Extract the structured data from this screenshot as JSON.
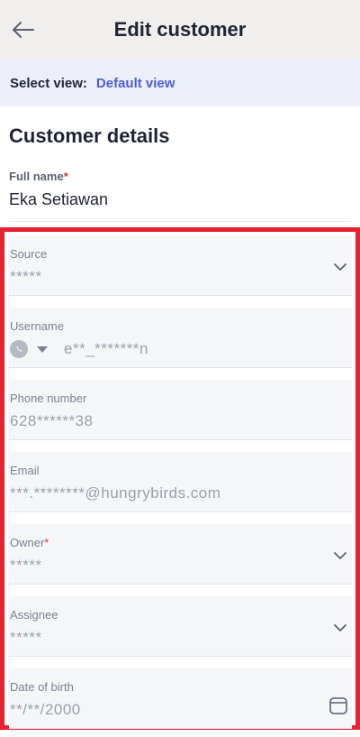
{
  "header": {
    "title": "Edit customer",
    "back_icon": "arrow-left-icon"
  },
  "view_bar": {
    "label": "Select view:",
    "link": "Default view"
  },
  "section": {
    "title": "Customer details"
  },
  "full_name": {
    "label": "Full name",
    "required": "*",
    "value": "Eka Setiawan"
  },
  "fields": {
    "source": {
      "label": "Source",
      "value": "*****"
    },
    "username": {
      "label": "Username",
      "value": "e**_*******n",
      "icon": "whatsapp-icon"
    },
    "phone": {
      "label": "Phone number",
      "value": "628******38"
    },
    "email": {
      "label": "Email",
      "value": "***.********@hungrybirds.com"
    },
    "owner": {
      "label": "Owner",
      "required": "*",
      "value": "*****"
    },
    "assignee": {
      "label": "Assignee",
      "value": "*****"
    },
    "dob": {
      "label": "Date of birth",
      "value": "**/**/2000"
    }
  },
  "colors": {
    "accent": "#4d5fd6",
    "required": "#e0334a",
    "highlight": "#e8202f"
  }
}
